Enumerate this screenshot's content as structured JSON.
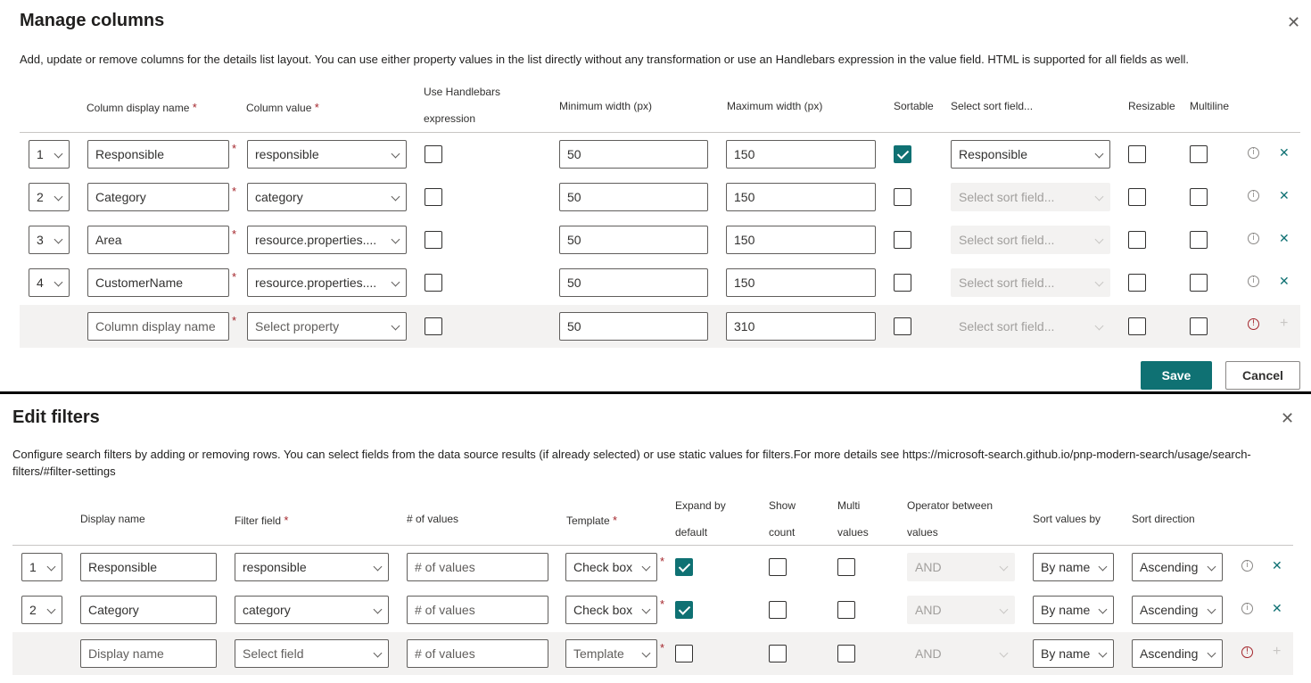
{
  "columns_panel": {
    "title": "Manage columns",
    "close_glyph": "✕",
    "description": "Add, update or remove columns for the details list layout. You can use either property values in the list directly without any transformation or use an Handlebars expression in the value field. HTML is supported for all fields as well.",
    "headers": {
      "display_name": "Column display name",
      "value": "Column value",
      "handlebars_line1": "Use Handlebars",
      "handlebars_line2": "expression",
      "min_width": "Minimum width (px)",
      "max_width": "Maximum width (px)",
      "sortable": "Sortable",
      "sort_field": "Select sort field...",
      "resizable": "Resizable",
      "multiline": "Multiline"
    },
    "required_mark": "*",
    "rows": [
      {
        "order": "1",
        "display_name": "Responsible",
        "value": "responsible",
        "handlebars": false,
        "min": "50",
        "max": "150",
        "sortable": true,
        "sort_field": "Responsible",
        "resizable": false,
        "multiline": false
      },
      {
        "order": "2",
        "display_name": "Category",
        "value": "category",
        "handlebars": false,
        "min": "50",
        "max": "150",
        "sortable": false,
        "sort_field": "",
        "resizable": false,
        "multiline": false
      },
      {
        "order": "3",
        "display_name": "Area",
        "value": "resource.properties....",
        "handlebars": false,
        "min": "50",
        "max": "150",
        "sortable": false,
        "sort_field": "",
        "resizable": false,
        "multiline": false
      },
      {
        "order": "4",
        "display_name": "CustomerName",
        "value": "resource.properties....",
        "handlebars": false,
        "min": "50",
        "max": "150",
        "sortable": false,
        "sort_field": "",
        "resizable": false,
        "multiline": false
      }
    ],
    "new_row": {
      "display_name_placeholder": "Column display name",
      "value_placeholder": "Select property",
      "min": "50",
      "max": "310",
      "sort_field_placeholder": "Select sort field..."
    },
    "save_label": "Save",
    "cancel_label": "Cancel"
  },
  "filters_panel": {
    "title": "Edit filters",
    "close_glyph": "✕",
    "description": "Configure search filters by adding or removing rows. You can select fields from the data source results (if already selected) or use static values for filters.For more details see https://microsoft-search.github.io/pnp-modern-search/usage/search-filters/#filter-settings",
    "headers": {
      "display_name": "Display name",
      "filter_field": "Filter field",
      "num_values": "# of values",
      "template": "Template",
      "expand_line1": "Expand by",
      "expand_line2": "default",
      "show_line1": "Show",
      "show_line2": "count",
      "multi_line1": "Multi",
      "multi_line2": "values",
      "operator_line1": "Operator between",
      "operator_line2": "values",
      "sort_by": "Sort values by",
      "sort_direction": "Sort direction"
    },
    "required_mark": "*",
    "num_values_placeholder": "# of values",
    "rows": [
      {
        "order": "1",
        "display_name": "Responsible",
        "filter_field": "responsible",
        "template": "Check box",
        "expand": true,
        "show_count": false,
        "multi": false,
        "operator": "AND",
        "sort_by": "By name",
        "sort_direction": "Ascending"
      },
      {
        "order": "2",
        "display_name": "Category",
        "filter_field": "category",
        "template": "Check box",
        "expand": true,
        "show_count": false,
        "multi": false,
        "operator": "AND",
        "sort_by": "By name",
        "sort_direction": "Ascending"
      }
    ],
    "new_row": {
      "display_name_placeholder": "Display name",
      "filter_field_placeholder": "Select field",
      "template_placeholder": "Template",
      "operator": "AND",
      "sort_by": "By name",
      "sort_direction": "Ascending"
    }
  },
  "colors": {
    "accent": "#0f7173",
    "required": "#a4262c",
    "shade": "#f3f2f1"
  },
  "icons": {
    "info": "i",
    "error": "!",
    "remove": "✕",
    "add": "+"
  }
}
